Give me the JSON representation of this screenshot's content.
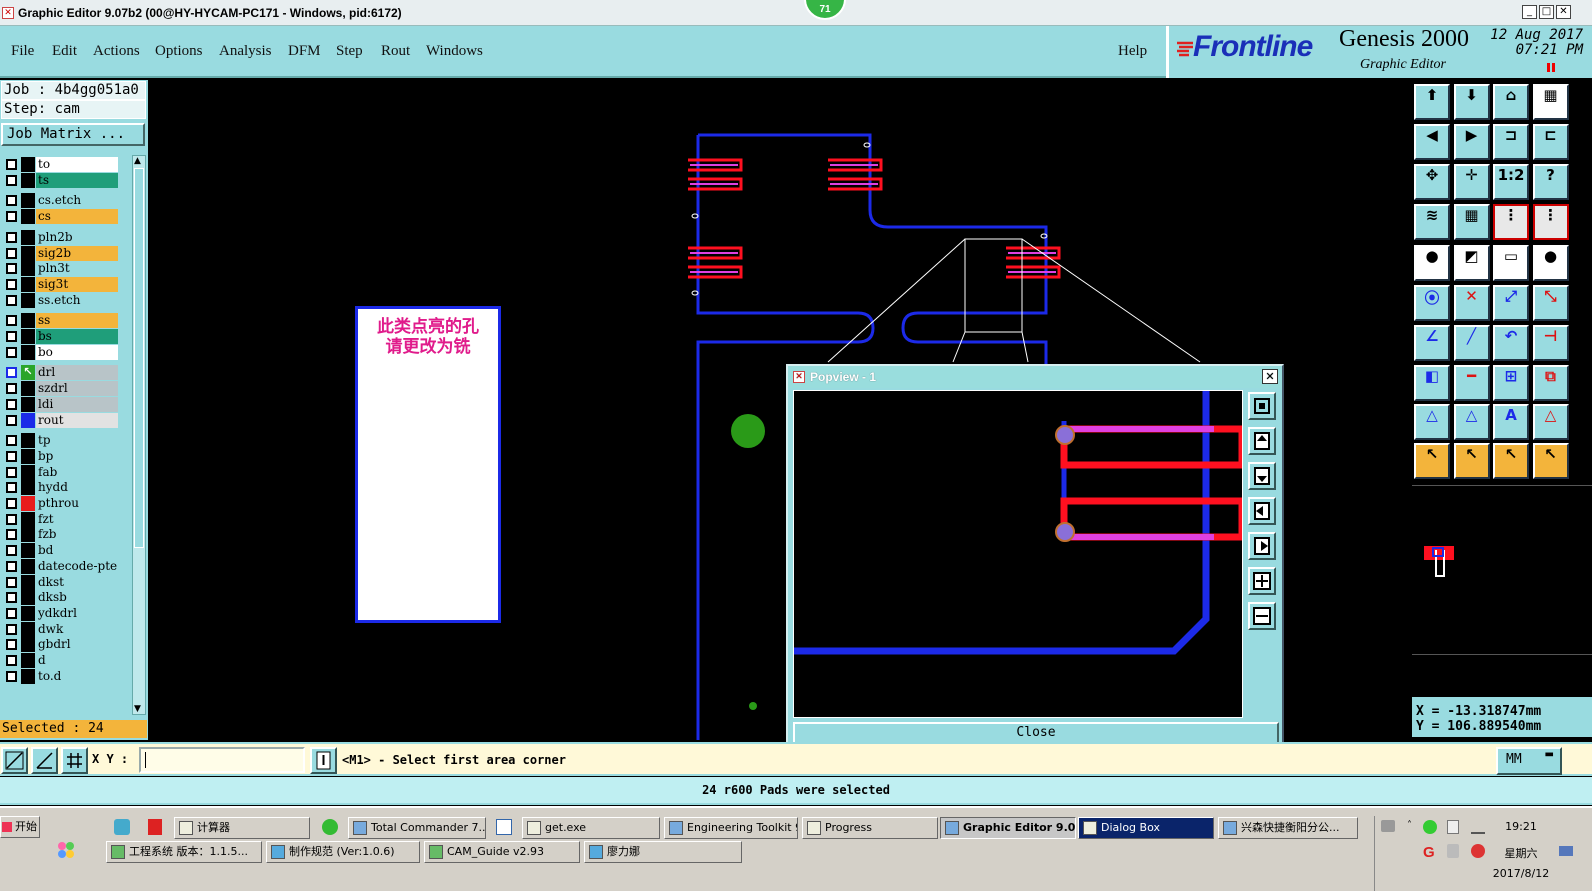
{
  "window": {
    "title": "Graphic Editor 9.07b2 (00@HY-HYCAM-PC171 - Windows, pid:6172)",
    "badge": "71"
  },
  "menu": {
    "items": [
      "File",
      "Edit",
      "Actions",
      "Options",
      "Analysis",
      "DFM",
      "Step",
      "Rout",
      "Windows"
    ],
    "help": "Help"
  },
  "brand": {
    "logo": "Frontline",
    "product": "Genesis 2000",
    "subtitle": "Graphic Editor",
    "date": "12 Aug 2017",
    "time": "07:21 PM"
  },
  "job": {
    "job_line": "Job : 4b4gg051a0",
    "step_line": "Step: cam",
    "matrix_button": "Job Matrix ...",
    "selected": "Selected : 24"
  },
  "layers": [
    {
      "name": "to",
      "bg": "#ffffff",
      "sw": "#000000"
    },
    {
      "name": "ts",
      "bg": "#1f9e7a",
      "sw": "#000000"
    },
    {
      "name": "cs.etch",
      "bg": "#99dbe0",
      "sw": "#000000"
    },
    {
      "name": "cs",
      "bg": "#f3b43b",
      "sw": "#000000"
    },
    {
      "name": "pln2b",
      "bg": "#99dbe0",
      "sw": "#000000"
    },
    {
      "name": "sig2b",
      "bg": "#f3b43b",
      "sw": "#000000"
    },
    {
      "name": "pln3t",
      "bg": "#99dbe0",
      "sw": "#000000"
    },
    {
      "name": "sig3t",
      "bg": "#f3b43b",
      "sw": "#000000"
    },
    {
      "name": "ss.etch",
      "bg": "#99dbe0",
      "sw": "#000000"
    },
    {
      "name": "ss",
      "bg": "#f3b43b",
      "sw": "#000000"
    },
    {
      "name": "bs",
      "bg": "#1f9e7a",
      "sw": "#000000"
    },
    {
      "name": "bo",
      "bg": "#ffffff",
      "sw": "#000000"
    },
    {
      "name": "drl",
      "bg": "#b8c4c8",
      "sw": "#2aa52a"
    },
    {
      "name": "szdrl",
      "bg": "#b8c4c8",
      "sw": "#000000"
    },
    {
      "name": "ldi",
      "bg": "#b8c4c8",
      "sw": "#000000"
    },
    {
      "name": "rout",
      "bg": "#e2e2e2",
      "sw": "#1c2ae8"
    },
    {
      "name": "tp",
      "bg": "#99dbe0",
      "sw": "#000000"
    },
    {
      "name": "bp",
      "bg": "#99dbe0",
      "sw": "#000000"
    },
    {
      "name": "fab",
      "bg": "#99dbe0",
      "sw": "#000000"
    },
    {
      "name": "hydd",
      "bg": "#99dbe0",
      "sw": "#000000"
    },
    {
      "name": "pthrou",
      "bg": "#99dbe0",
      "sw": "#e81c1c"
    },
    {
      "name": "fzt",
      "bg": "#99dbe0",
      "sw": "#000000"
    },
    {
      "name": "fzb",
      "bg": "#99dbe0",
      "sw": "#000000"
    },
    {
      "name": "bd",
      "bg": "#99dbe0",
      "sw": "#000000"
    },
    {
      "name": "datecode-pte",
      "bg": "#99dbe0",
      "sw": "#000000"
    },
    {
      "name": "dkst",
      "bg": "#99dbe0",
      "sw": "#000000"
    },
    {
      "name": "dksb",
      "bg": "#99dbe0",
      "sw": "#000000"
    },
    {
      "name": "ydkdrl",
      "bg": "#99dbe0",
      "sw": "#000000"
    },
    {
      "name": "dwk",
      "bg": "#99dbe0",
      "sw": "#000000"
    },
    {
      "name": "gbdrl",
      "bg": "#99dbe0",
      "sw": "#000000"
    },
    {
      "name": "d",
      "bg": "#99dbe0",
      "sw": "#000000"
    },
    {
      "name": "to.d",
      "bg": "#99dbe0",
      "sw": "#000000"
    }
  ],
  "note": {
    "line1": "此类点亮的孔",
    "line2": "请更改为铣"
  },
  "popview": {
    "title": "Popview - 1",
    "close": "Close"
  },
  "coords": {
    "x": "X = -13.318747mm",
    "y": "Y = 106.889540mm"
  },
  "command": {
    "xy_label": "X Y :",
    "prompt": "<M1> - Select first area corner",
    "unit": "MM"
  },
  "status": "24 r600 Pads were selected",
  "taskbar": {
    "start": "开始",
    "row1": [
      "计算器",
      "Total Commander 7....",
      "get.exe",
      "Engineering Toolkit 9...",
      "Progress",
      "Graphic Editor 9.0...",
      "Dialog Box",
      "兴森快捷衡阳分公..."
    ],
    "row2": [
      "工程系统  版本：1.1.5...",
      "制作规范 (Ver:1.0.6)",
      "CAM_Guide v2.93",
      "廖力娜"
    ],
    "clock": "19:21",
    "weekday": "星期六",
    "date": "2017/8/12"
  },
  "colors": {
    "accent": "#99dbe0",
    "pad_red": "#ff1020",
    "rout_blue": "#1c2ae8",
    "highlight": "#e040e0",
    "selected_orange": "#f3b43b"
  }
}
